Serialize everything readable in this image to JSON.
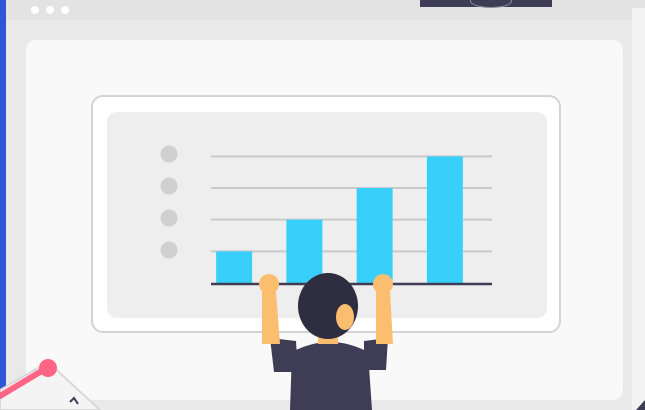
{
  "colors": {
    "background_blue": "#2f55d4",
    "window_gray": "#e9e9e9",
    "bar_blue": "#38d0fb",
    "gridline": "#c9c9c9",
    "axis": "#3f3d56",
    "legend_dot": "#d0d0d0",
    "skin": "#fbbe6f",
    "hair": "#2f2e41",
    "shirt": "#3f3d56"
  },
  "chart_data": {
    "type": "bar",
    "categories": [
      "",
      "",
      "",
      ""
    ],
    "values": [
      1,
      2,
      3,
      4
    ],
    "ylim": [
      0,
      4.2
    ],
    "grid": true,
    "legend": "left",
    "legend_markers": 4
  },
  "icons": {
    "window_controls": "three-dots-icon",
    "legend_marker": "circle-icon"
  }
}
